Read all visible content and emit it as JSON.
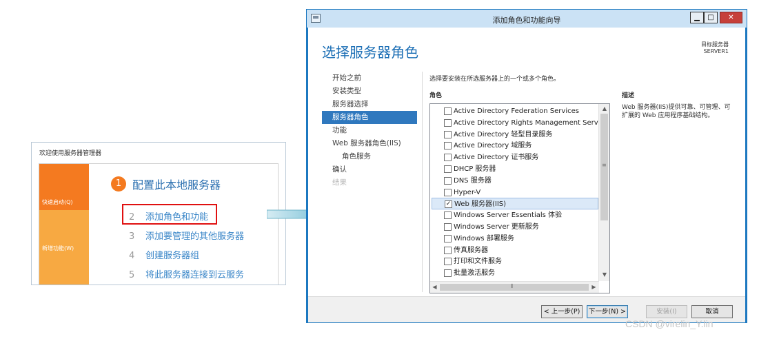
{
  "server_manager": {
    "title": "欢迎使用服务器管理器",
    "side_quick": "快速启动(Q)",
    "side_new": "新增功能(W)",
    "step1_num": "1",
    "step1_label": "配置此本地服务器",
    "steps": [
      {
        "num": "2",
        "label": "添加角色和功能"
      },
      {
        "num": "3",
        "label": "添加要管理的其他服务器"
      },
      {
        "num": "4",
        "label": "创建服务器组"
      },
      {
        "num": "5",
        "label": "将此服务器连接到云服务"
      }
    ]
  },
  "wizard": {
    "window_title": "添加角色和功能向导",
    "page_title": "选择服务器角色",
    "target_label": "目标服务器",
    "target_server": "SERVER1",
    "nav": [
      {
        "label": "开始之前",
        "state": "normal"
      },
      {
        "label": "安装类型",
        "state": "normal"
      },
      {
        "label": "服务器选择",
        "state": "normal"
      },
      {
        "label": "服务器角色",
        "state": "active"
      },
      {
        "label": "功能",
        "state": "normal"
      },
      {
        "label": "Web 服务器角色(IIS)",
        "state": "normal"
      },
      {
        "label": "角色服务",
        "state": "sub"
      },
      {
        "label": "确认",
        "state": "normal"
      },
      {
        "label": "结果",
        "state": "disabled"
      }
    ],
    "instruction": "选择要安装在所选服务器上的一个或多个角色。",
    "roles_label": "角色",
    "roles": [
      {
        "label": "Active Directory Federation Services",
        "checked": false
      },
      {
        "label": "Active Directory Rights Management Services",
        "checked": false
      },
      {
        "label": "Active Directory 轻型目录服务",
        "checked": false
      },
      {
        "label": "Active Directory 域服务",
        "checked": false
      },
      {
        "label": "Active Directory 证书服务",
        "checked": false
      },
      {
        "label": "DHCP 服务器",
        "checked": false
      },
      {
        "label": "DNS 服务器",
        "checked": false
      },
      {
        "label": "Hyper-V",
        "checked": false
      },
      {
        "label": "Web 服务器(IIS)",
        "checked": true
      },
      {
        "label": "Windows Server Essentials 体验",
        "checked": false
      },
      {
        "label": "Windows Server 更新服务",
        "checked": false
      },
      {
        "label": "Windows 部署服务",
        "checked": false
      },
      {
        "label": "传真服务器",
        "checked": false
      },
      {
        "label": "打印和文件服务",
        "checked": false
      },
      {
        "label": "批量激活服务",
        "checked": false
      }
    ],
    "description_label": "描述",
    "description_text": "Web 服务器(IIS)提供可靠、可管理、可扩展的 Web 应用程序基础结构。",
    "buttons": {
      "prev": "< 上一步(P)",
      "next": "下一步(N) >",
      "install": "安装(I)",
      "cancel": "取消"
    }
  },
  "watermark": "CSDN @virelin_Y.lin"
}
